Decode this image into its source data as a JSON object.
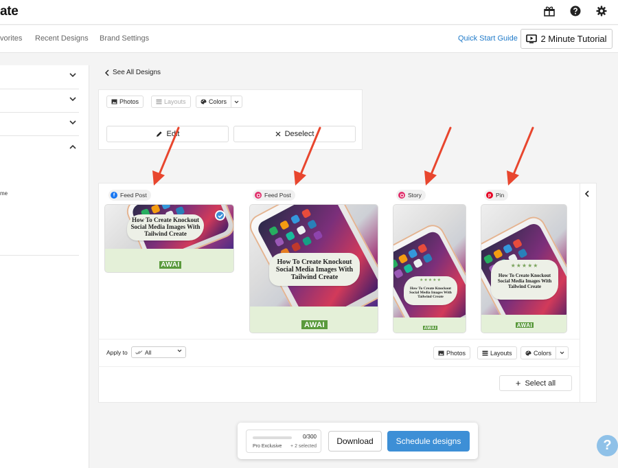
{
  "app": {
    "logo_text": "ate"
  },
  "header": {
    "icons": [
      "gift-icon",
      "help-circle-icon",
      "gear-icon"
    ]
  },
  "nav": {
    "tabs": [
      "vorites",
      "Recent Designs",
      "Brand Settings"
    ],
    "quick_start": "Quick Start Guide",
    "tutorial": "2 Minute Tutorial"
  },
  "sidebar": {
    "partial_text": "me"
  },
  "editor": {
    "back_link": "See All Designs",
    "toolbar": {
      "photos": "Photos",
      "layouts": "Layouts",
      "colors": "Colors"
    },
    "edit": "Edit",
    "deselect": "Deselect"
  },
  "designs": [
    {
      "platform": "Feed Post",
      "network": "facebook",
      "headline": "How To Create Knockout Social Media Images With Tailwind Create",
      "brand": "AWAI",
      "selected": true
    },
    {
      "platform": "Feed Post",
      "network": "instagram",
      "headline": "How To Create Knockout Social Media Images With Tailwind Create",
      "brand": "AWAI",
      "selected": false
    },
    {
      "platform": "Story",
      "network": "instagram",
      "headline": "How To Create Knockout Social Media Images With Tailwind Create",
      "stars": "★★★★★",
      "brand": "AWAI",
      "selected": false
    },
    {
      "platform": "Pin",
      "network": "pinterest",
      "headline": "How To Create Knockout Social Media Images With Tailwind Create",
      "stars": "★★★★★",
      "brand": "AWAI",
      "selected": false
    }
  ],
  "apply": {
    "label": "Apply to",
    "value": "All"
  },
  "panel_toolbar": {
    "photos": "Photos",
    "layouts": "Layouts",
    "colors": "Colors"
  },
  "select_all": "Select all",
  "quota": {
    "count": "0/300",
    "used": 0,
    "limit": 300,
    "label": "Pro Exclusive",
    "selected": "+ 2 selected"
  },
  "actions": {
    "download": "Download",
    "schedule": "Schedule designs"
  },
  "help": "?",
  "colors": {
    "accent": "#3d8fd6",
    "link": "#1f7ac9",
    "facebook": "#1877f2",
    "instagram": "#e1306c",
    "pinterest": "#e60023",
    "annotation_arrow": "#e8462e",
    "brand_green": "#5a9a3c"
  }
}
